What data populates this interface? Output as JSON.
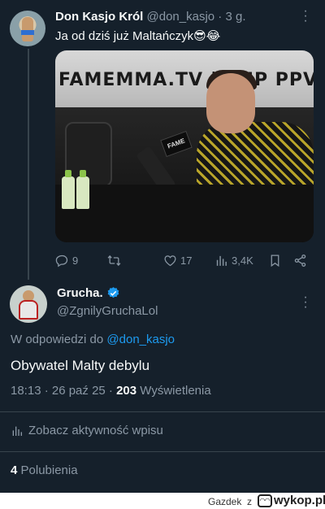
{
  "tweet1": {
    "display_name": "Don Kasjo Król",
    "handle": "@don_kasjo",
    "time": " · 3 g.",
    "text": "Ja od dziś już Maltańczyk😎😂",
    "media": {
      "banner_text": "FAMEMMA.TV | KUP PPV JUŻ",
      "mic_text": "FAME"
    },
    "replies": "9",
    "reposts": "",
    "likes": "17",
    "views": "3,4K"
  },
  "tweet2": {
    "display_name": "Grucha.",
    "handle": "@ZgnilyGruchaLol",
    "reply_prefix": "W odpowiedzi do ",
    "reply_handle": "@don_kasjo",
    "text": "Obywatel Malty debylu",
    "time": "18:13 · 26 paź 25 · ",
    "views_count": "203",
    "views_label": " Wyświetlenia",
    "activity_label": "Zobacz aktywność wpisu",
    "likes_count": "4",
    "likes_label": " Polubienia"
  },
  "footer": {
    "user": "Gazdek",
    "z": "z",
    "site": "wykop.pl"
  },
  "colors": {
    "background": "#15202b",
    "accent": "#1d9bf0",
    "muted": "#8b98a5"
  }
}
